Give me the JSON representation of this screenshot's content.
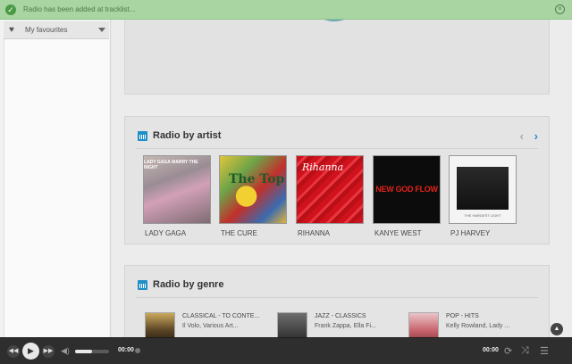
{
  "notification": {
    "message": "Radio has been added at tracklist..."
  },
  "sidebar": {
    "favourites_label": "My favourites"
  },
  "artist_section": {
    "title": "Radio by artist",
    "artists": [
      {
        "name": "LADY GAGA",
        "cover_text": "LADY GAGA MARRY THE NIGHT"
      },
      {
        "name": "THE CURE",
        "cover_text": "The Top"
      },
      {
        "name": "RIHANNA",
        "cover_text": "Rihanna"
      },
      {
        "name": "KANYE WEST",
        "cover_text": "NEW GOD FLOW"
      },
      {
        "name": "PJ HARVEY",
        "cover_text": "THE HARDEST LIGHT"
      }
    ]
  },
  "genre_section": {
    "title": "Radio by genre",
    "genres": [
      {
        "title": "CLASSICAL - TO CONTE...",
        "artists": "Il Volo, Various Art..."
      },
      {
        "title": "JAZZ - CLASSICS",
        "artists": "Frank Zappa, Ella Fi..."
      },
      {
        "title": "POP - HITS",
        "artists": "Kelly Rowland, Lady ..."
      }
    ]
  },
  "player": {
    "time_elapsed": "00:00",
    "time_total": "00:00",
    "volume": 0.5
  }
}
